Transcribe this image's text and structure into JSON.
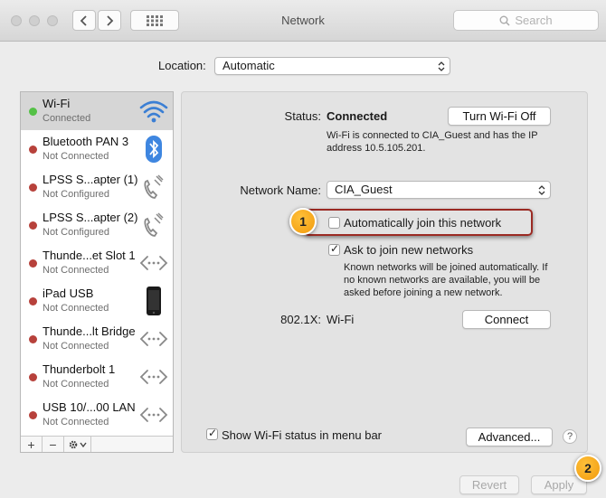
{
  "window": {
    "title": "Network"
  },
  "search": {
    "placeholder": "Search"
  },
  "location": {
    "label": "Location:",
    "value": "Automatic"
  },
  "services": [
    {
      "name": "Wi-Fi",
      "status": "Connected",
      "icon": "wifi-icon",
      "dot": "green"
    },
    {
      "name": "Bluetooth PAN 3",
      "status": "Not Connected",
      "icon": "bluetooth-icon",
      "dot": "red"
    },
    {
      "name": "LPSS S...apter (1)",
      "status": "Not Configured",
      "icon": "phone-icon",
      "dot": "red"
    },
    {
      "name": "LPSS S...apter (2)",
      "status": "Not Configured",
      "icon": "phone-icon",
      "dot": "red"
    },
    {
      "name": "Thunde...et Slot 1",
      "status": "Not Connected",
      "icon": "ethernet-icon",
      "dot": "red"
    },
    {
      "name": "iPad USB",
      "status": "Not Connected",
      "icon": "ipad-icon",
      "dot": "red"
    },
    {
      "name": "Thunde...lt Bridge",
      "status": "Not Connected",
      "icon": "ethernet-icon",
      "dot": "red"
    },
    {
      "name": "Thunderbolt 1",
      "status": "Not Connected",
      "icon": "ethernet-icon",
      "dot": "red"
    },
    {
      "name": "USB 10/...00 LAN",
      "status": "Not Connected",
      "icon": "ethernet-icon",
      "dot": "red"
    }
  ],
  "sidebar_toolbar": {
    "add": "+",
    "remove": "−"
  },
  "detail": {
    "status_label": "Status:",
    "status_value": "Connected",
    "turn_off_button": "Turn Wi-Fi Off",
    "status_description_line1": "Wi-Fi is connected to CIA_Guest and has the IP",
    "status_description_line2": "address 10.5.105.201.",
    "network_name_label": "Network Name:",
    "network_name_value": "CIA_Guest",
    "auto_join_label": "Automatically join this network",
    "auto_join_checked": false,
    "ask_join_label": "Ask to join new networks",
    "ask_join_checked": true,
    "ask_join_help_line1": "Known networks will be joined automatically. If",
    "ask_join_help_line2": "no known networks are available, you will be",
    "ask_join_help_line3": "asked before joining a new network.",
    "dot1x_label": "802.1X:",
    "dot1x_value": "Wi-Fi",
    "connect_button": "Connect",
    "show_status_label": "Show Wi-Fi status in menu bar",
    "show_status_checked": true,
    "advanced_button": "Advanced...",
    "help_button": "?"
  },
  "footer": {
    "revert_button": "Revert",
    "apply_button": "Apply"
  },
  "callouts": [
    "1",
    "2"
  ],
  "colors": {
    "connected": "#54c146",
    "not_connected": "#b7413b",
    "highlight": "#9b2a23",
    "badge": "#f5a623"
  }
}
